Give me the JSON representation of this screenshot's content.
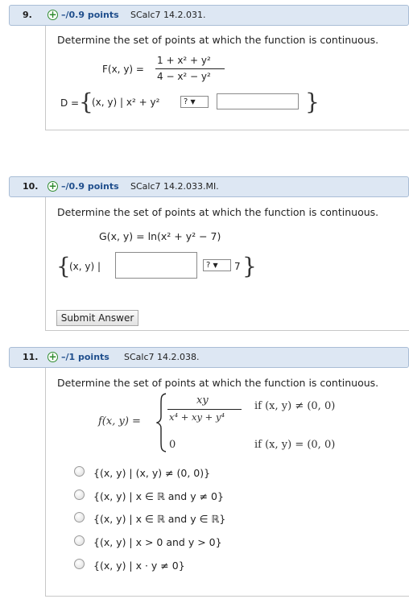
{
  "questions": [
    {
      "number": "9.",
      "points": "–/0.9 points",
      "source": "SCalc7 14.2.031.",
      "prompt": "Determine the set of points at which the function is continuous.",
      "func_label": "F(x, y) =",
      "numerator": "1 + x² + y²",
      "denominator": "4 − x² − y²",
      "set_prefix": "D =",
      "set_body": "(x, y) | x² + y²",
      "select_value": "?",
      "answer_value": ""
    },
    {
      "number": "10.",
      "points": "–/0.9 points",
      "source": "SCalc7 14.2.033.MI.",
      "prompt": "Determine the set of points at which the function is continuous.",
      "function": "G(x, y) = ln(x² + y² − 7)",
      "set_body": "(x, y) |",
      "answer_value": "",
      "select_value": "?",
      "set_suffix": "7",
      "submit_label": "Submit Answer"
    },
    {
      "number": "11.",
      "points": "–/1 points",
      "source": "SCalc7 14.2.038.",
      "prompt": "Determine the set of points at which the function is continuous.",
      "func_label": "f(x, y) =",
      "case1_num": "xy",
      "case1_den": "x⁴ + xy + y⁴",
      "case1_cond": "if (x, y) ≠ (0, 0)",
      "case2_val": "0",
      "case2_cond": "if (x, y) = (0, 0)",
      "options": [
        "{(x, y) | (x, y) ≠ (0, 0)}",
        "{(x, y) | x ∈ ℝ and y ≠ 0}",
        "{(x, y) | x ∈ ℝ and y ∈ ℝ}",
        "{(x, y) | x > 0 and y > 0}",
        "{(x, y) | x · y ≠ 0}"
      ]
    }
  ]
}
